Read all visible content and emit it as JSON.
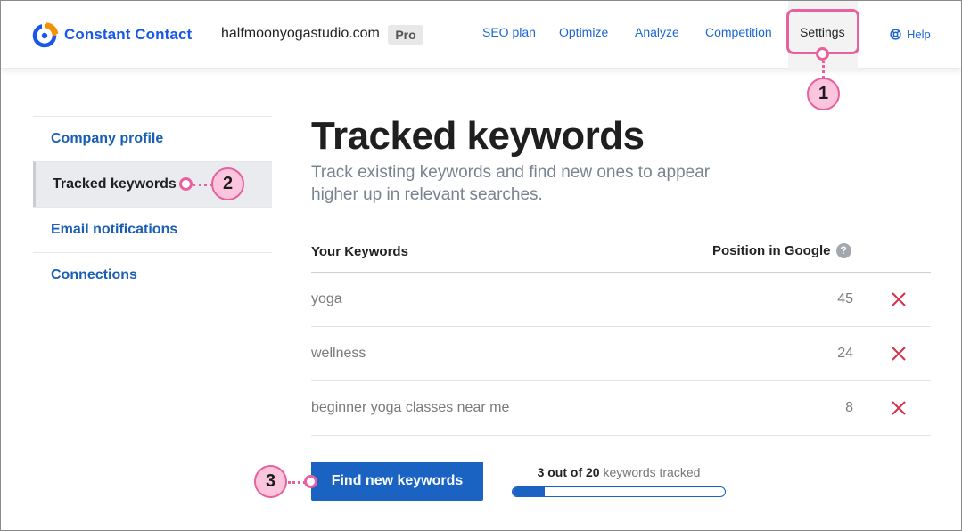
{
  "brand": {
    "name": "Constant Contact",
    "color": "#1856ed",
    "accent": "#f39200"
  },
  "header": {
    "domain": "halfmoonyogastudio.com",
    "plan_badge": "Pro",
    "nav": [
      {
        "label": "SEO plan"
      },
      {
        "label": "Optimize"
      },
      {
        "label": "Analyze"
      },
      {
        "label": "Competition"
      },
      {
        "label": "Settings",
        "active": true
      }
    ],
    "help_label": "Help"
  },
  "callouts": {
    "one": "1",
    "two": "2",
    "three": "3",
    "color": "#e8609e"
  },
  "sidebar": {
    "items": [
      {
        "label": "Company profile"
      },
      {
        "label": "Tracked keywords",
        "active": true
      },
      {
        "label": "Email notifications"
      },
      {
        "label": "Connections"
      }
    ]
  },
  "main": {
    "title": "Tracked keywords",
    "subtitle": "Track existing keywords and find new ones to appear higher up in relevant searches.",
    "table": {
      "col_keywords": "Your Keywords",
      "col_position": "Position in Google",
      "help_glyph": "?",
      "rows": [
        {
          "keyword": "yoga",
          "position": "45"
        },
        {
          "keyword": "wellness",
          "position": "24"
        },
        {
          "keyword": "beginner yoga classes near me",
          "position": "8"
        }
      ]
    },
    "find_button": "Find new keywords",
    "progress": {
      "count_text": "3 out of 20",
      "suffix_text": " keywords tracked",
      "fraction": 0.15
    }
  }
}
